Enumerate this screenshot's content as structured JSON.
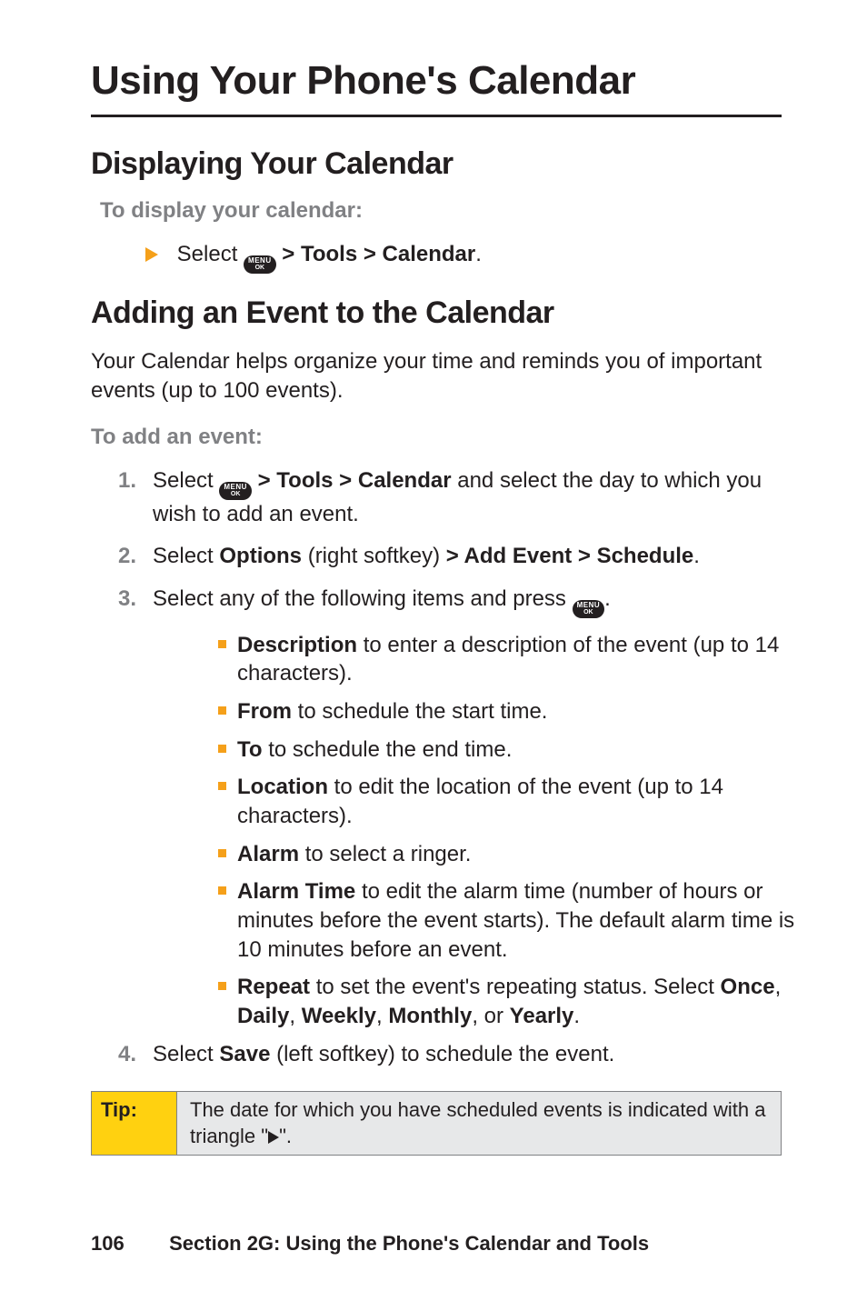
{
  "title": "Using Your Phone's Calendar",
  "sections": {
    "display": {
      "heading": "Displaying Your Calendar",
      "instruction": "To display your calendar:",
      "step_pre": "Select ",
      "step_bold": " > Tools > Calendar",
      "step_post": "."
    },
    "add": {
      "heading": "Adding an Event to the Calendar",
      "intro": "Your Calendar helps organize your time and reminds you of important events (up to 100 events).",
      "instruction": "To add an event:",
      "steps": {
        "s1": {
          "num": "1.",
          "pre": "Select ",
          "bold": " > Tools > Calendar",
          "post": " and select the day to which you wish to add an event."
        },
        "s2": {
          "num": "2.",
          "pre": "Select ",
          "b1": "Options",
          "mid": " (right softkey) ",
          "b2": "> Add Event > Schedule",
          "post": "."
        },
        "s3": {
          "num": "3.",
          "pre": "Select any of the following items and press ",
          "post": "."
        },
        "s4": {
          "num": "4.",
          "pre": "Select ",
          "b1": "Save",
          "post": " (left softkey) to schedule the event."
        }
      },
      "bullets": {
        "b1": {
          "bold": "Description",
          "text": " to enter a description of the event (up to 14 characters)."
        },
        "b2": {
          "bold": "From",
          "text": " to schedule the start time."
        },
        "b3": {
          "bold": "To",
          "text": " to schedule the end time."
        },
        "b4": {
          "bold": "Location",
          "text": " to edit the location of the event (up to 14 characters)."
        },
        "b5": {
          "bold": "Alarm",
          "text": " to select a ringer."
        },
        "b6": {
          "bold": "Alarm Time",
          "text": " to edit the alarm time (number of hours or minutes before the event starts). The default alarm time is 10 minutes before an event."
        },
        "b7": {
          "bold": "Repeat",
          "pre": " to set the event's repeating status. Select ",
          "o1": "Once",
          "c1": ", ",
          "o2": "Daily",
          "c2": ", ",
          "o3": "Weekly",
          "c3": ", ",
          "o4": "Monthly",
          "c4": ", or ",
          "o5": "Yearly",
          "post": "."
        }
      }
    }
  },
  "tip": {
    "label": "Tip:",
    "text_pre": "The date for which you have scheduled events is indicated with a triangle \"",
    "text_post": "\"."
  },
  "footer": {
    "page_number": "106",
    "section": "Section 2G: Using the Phone's Calendar and Tools"
  },
  "icons": {
    "menu_top": "MENU",
    "menu_bottom": "OK"
  }
}
